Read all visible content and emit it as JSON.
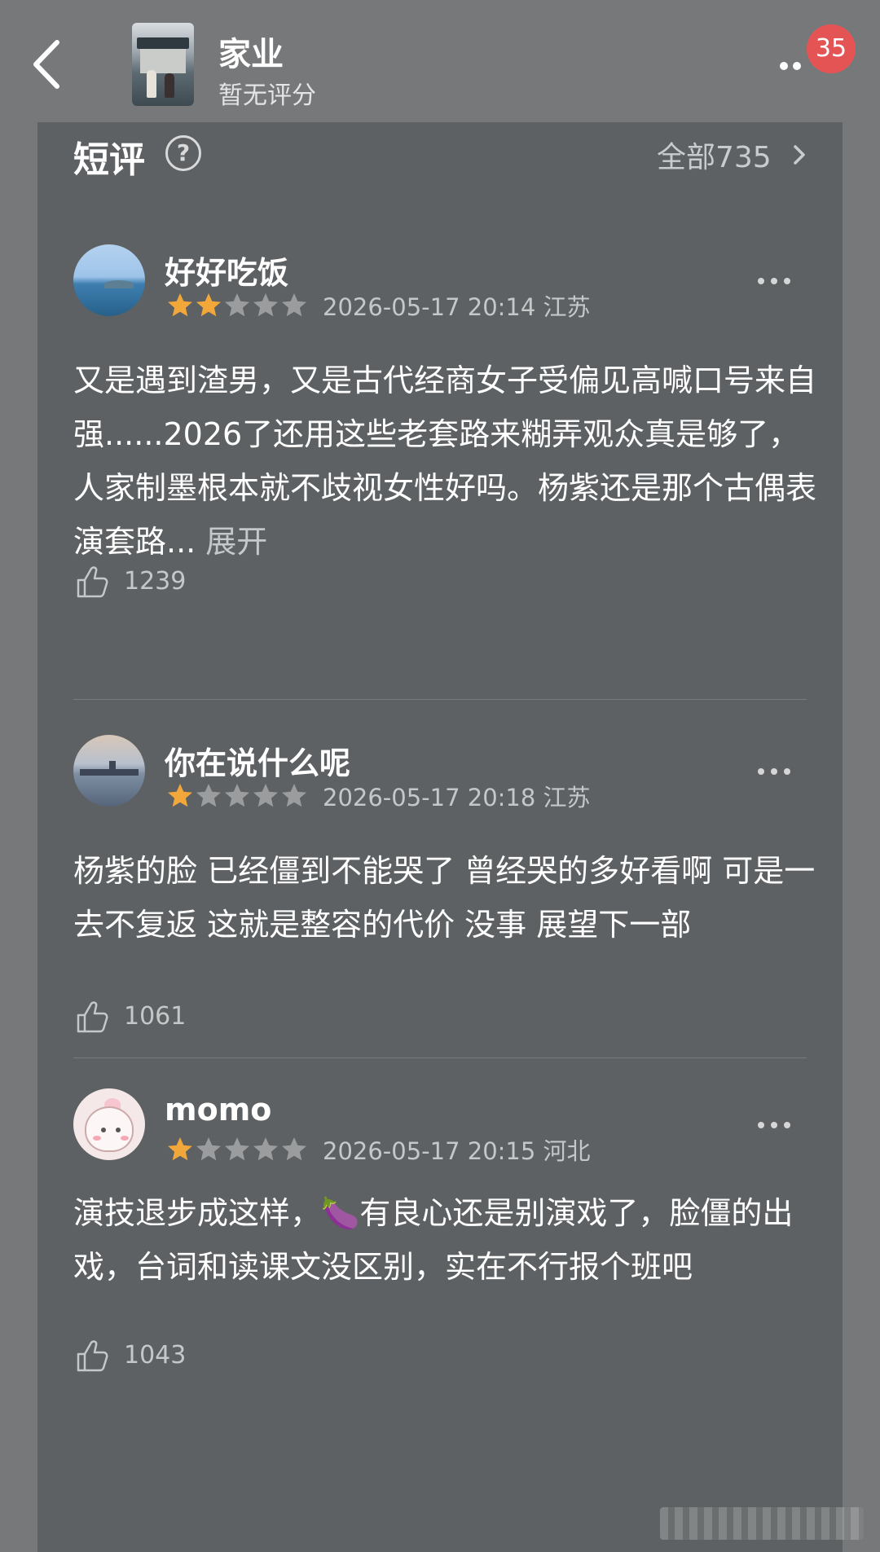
{
  "header": {
    "title": "家业",
    "subtitle": "暂无评分",
    "badge_count": "35"
  },
  "section": {
    "title": "短评",
    "all_label": "全部735"
  },
  "reviews": [
    {
      "username": "好好吃饭",
      "rating": 2,
      "max_rating": 5,
      "meta": "2026-05-17 20:14 江苏",
      "text": "又是遇到渣男，又是古代经商女子受偏见高喊口号来自强......2026了还用这些老套路来糊弄观众真是够了，人家制墨根本就不歧视女性好吗。杨紫还是那个古偶表演套路...",
      "expand_label": "展开",
      "likes": "1239"
    },
    {
      "username": "你在说什么呢",
      "rating": 1,
      "max_rating": 5,
      "meta": "2026-05-17 20:18 江苏",
      "text": "杨紫的脸 已经僵到不能哭了 曾经哭的多好看啊 可是一去不复返 这就是整容的代价 没事 展望下一部",
      "expand_label": "",
      "likes": "1061"
    },
    {
      "username": "momo",
      "rating": 1,
      "max_rating": 5,
      "meta": "2026-05-17 20:15 河北",
      "text": "演技退步成这样，🍆有良心还是别演戏了，脸僵的出戏，台词和读课文没区别，实在不行报个班吧",
      "expand_label": "",
      "likes": "1043"
    }
  ],
  "colors": {
    "background": "#76787a",
    "card": "#5d6163",
    "star_filled": "#f2a73b",
    "star_empty": "#9a9c9e",
    "badge": "#e55454"
  }
}
